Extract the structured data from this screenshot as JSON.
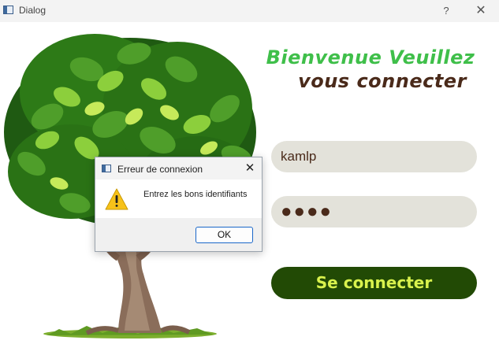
{
  "window": {
    "title": "Dialog",
    "help_label": "?",
    "close_label": "✕"
  },
  "heading": {
    "line1": "Bienvenue Veuillez",
    "line2": "vous connecter"
  },
  "form": {
    "username_value": "kamlp",
    "password_value": "●●●●",
    "login_button": "Se connecter"
  },
  "message_box": {
    "title": "Erreur de connexion",
    "close_label": "✕",
    "text": "Entrez les bons identifiants",
    "ok_button": "OK",
    "icon": "warning-icon"
  },
  "colors": {
    "heading_green": "#3fbf4a",
    "heading_brown": "#4a2a1a",
    "input_bg": "#e3e2da",
    "button_bg": "#224a05",
    "button_text": "#d9f24d"
  }
}
